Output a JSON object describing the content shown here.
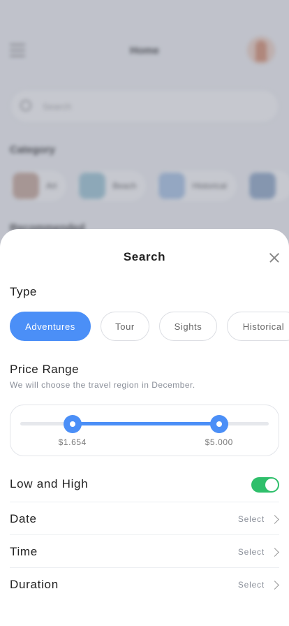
{
  "background": {
    "title": "Home",
    "search_placeholder": "Search",
    "category_title": "Category",
    "recommended_title": "Recommended",
    "categories": [
      {
        "label": "Art"
      },
      {
        "label": "Beach"
      },
      {
        "label": "Historical"
      },
      {
        "label": ""
      }
    ]
  },
  "sheet": {
    "title": "Search",
    "type_label": "Type",
    "types": [
      {
        "label": "Adventures",
        "active": true
      },
      {
        "label": "Tour",
        "active": false
      },
      {
        "label": "Sights",
        "active": false
      },
      {
        "label": "Historical",
        "active": false
      }
    ],
    "price_label": "Price Range",
    "price_subtitle": "We will choose the travel region in December.",
    "price_range": {
      "min_label": "$1.654",
      "max_label": "$5.000",
      "min_fraction": 0.21,
      "max_fraction": 0.8
    },
    "low_high_label": "Low and High",
    "low_high_enabled": true,
    "rows": [
      {
        "label": "Date",
        "value": "Select"
      },
      {
        "label": "Time",
        "value": "Select"
      },
      {
        "label": "Duration",
        "value": "Select"
      }
    ]
  },
  "colors": {
    "accent": "#4b8ff7",
    "toggle_on": "#2fbf6b"
  }
}
